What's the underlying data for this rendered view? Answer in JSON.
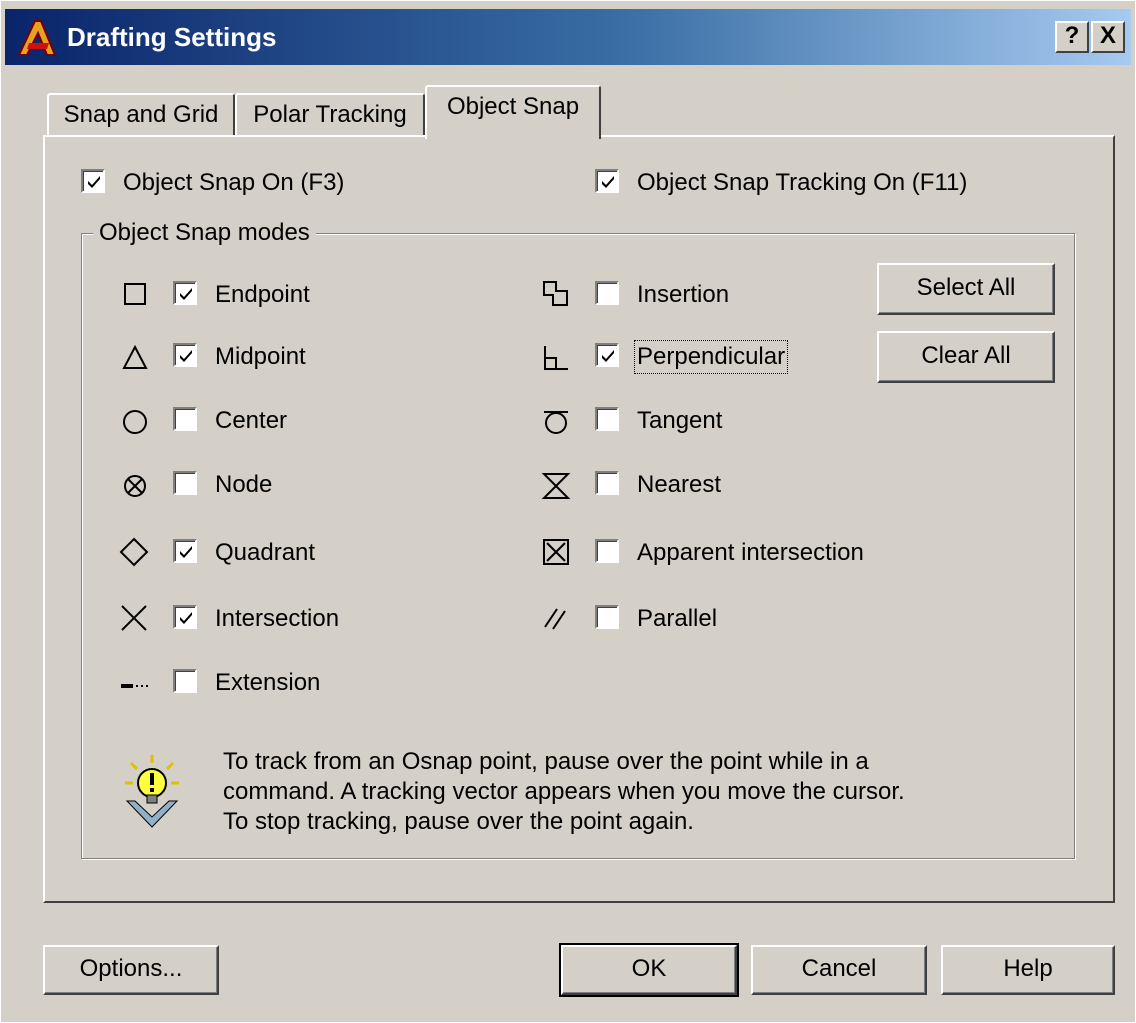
{
  "window": {
    "title": "Drafting Settings",
    "help_btn": "?",
    "close_btn": "X"
  },
  "tabs": [
    {
      "label": "Snap and Grid"
    },
    {
      "label": "Polar Tracking"
    },
    {
      "label": "Object Snap"
    }
  ],
  "object_snap_on": {
    "label": "Object Snap On (F3)",
    "checked": true
  },
  "object_snap_tracking_on": {
    "label": "Object Snap Tracking On (F11)",
    "checked": true
  },
  "modes": {
    "group_title": "Object Snap modes",
    "left": [
      {
        "label": "Endpoint",
        "checked": true,
        "icon": "endpoint-icon"
      },
      {
        "label": "Midpoint",
        "checked": true,
        "icon": "midpoint-icon"
      },
      {
        "label": "Center",
        "checked": false,
        "icon": "center-icon"
      },
      {
        "label": "Node",
        "checked": false,
        "icon": "node-icon"
      },
      {
        "label": "Quadrant",
        "checked": true,
        "icon": "quadrant-icon"
      },
      {
        "label": "Intersection",
        "checked": true,
        "icon": "intersection-icon"
      },
      {
        "label": "Extension",
        "checked": false,
        "icon": "extension-icon"
      }
    ],
    "right": [
      {
        "label": "Insertion",
        "checked": false,
        "icon": "insertion-icon"
      },
      {
        "label": "Perpendicular",
        "checked": true,
        "icon": "perpendicular-icon"
      },
      {
        "label": "Tangent",
        "checked": false,
        "icon": "tangent-icon"
      },
      {
        "label": "Nearest",
        "checked": false,
        "icon": "nearest-icon"
      },
      {
        "label": "Apparent intersection",
        "checked": false,
        "icon": "apparent-intersection-icon"
      },
      {
        "label": "Parallel",
        "checked": false,
        "icon": "parallel-icon"
      }
    ],
    "select_all": "Select All",
    "clear_all": "Clear All"
  },
  "tip": {
    "line1": "To track from an Osnap point, pause over the point while in a",
    "line2": "command.  A tracking vector appears when you move the cursor.",
    "line3": "To stop tracking, pause over the point again."
  },
  "buttons": {
    "options": "Options...",
    "ok": "OK",
    "cancel": "Cancel",
    "help": "Help"
  }
}
